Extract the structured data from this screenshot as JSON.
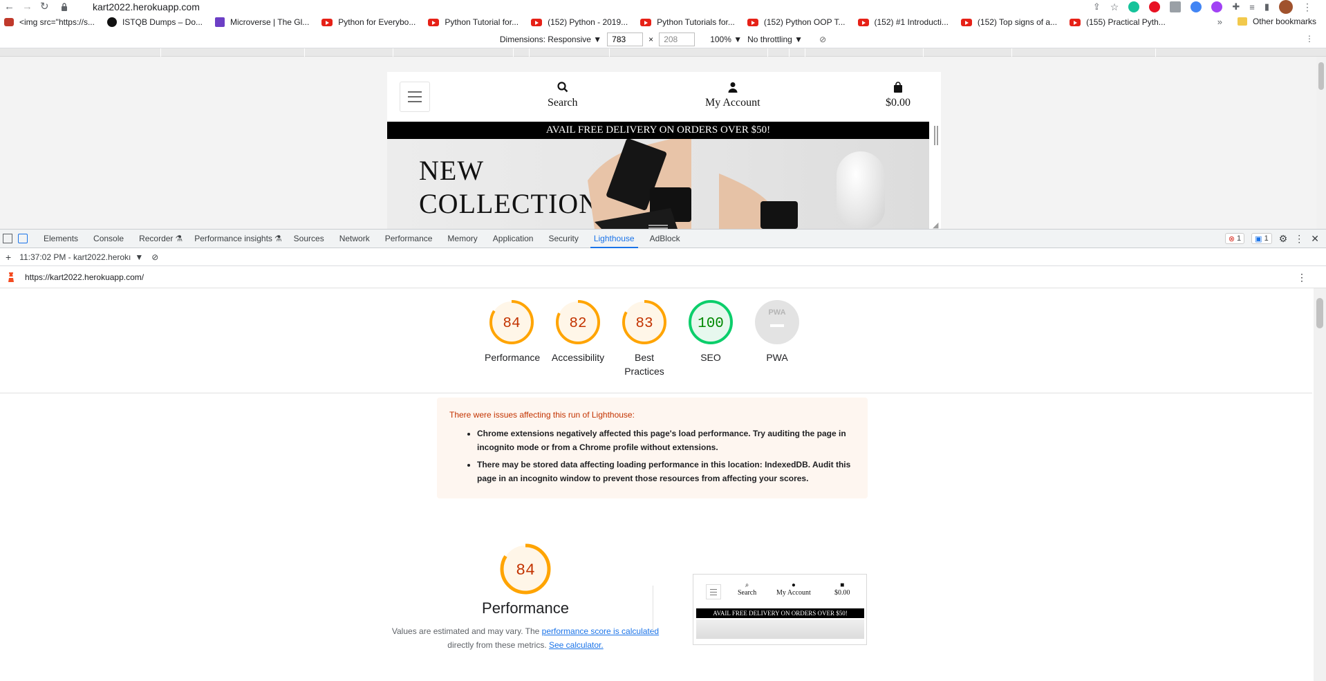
{
  "browser": {
    "url": "kart2022.herokuapp.com",
    "bookmarks": [
      {
        "label": "<img src=\"https://s...",
        "icon": "squirrel-icon"
      },
      {
        "label": "ISTQB Dumps – Do...",
        "icon": "g-logo-icon"
      },
      {
        "label": "Microverse | The Gl...",
        "icon": "microverse-icon"
      },
      {
        "label": "Python for Everybo...",
        "icon": "youtube-icon"
      },
      {
        "label": "Python Tutorial for...",
        "icon": "youtube-icon"
      },
      {
        "label": "(152) Python - 2019...",
        "icon": "youtube-icon"
      },
      {
        "label": "Python Tutorials for...",
        "icon": "youtube-icon"
      },
      {
        "label": "(152) Python OOP T...",
        "icon": "youtube-icon"
      },
      {
        "label": "(152) #1 Introducti...",
        "icon": "youtube-icon"
      },
      {
        "label": "(152) Top signs of a...",
        "icon": "youtube-icon"
      },
      {
        "label": "(155) Practical Pyth...",
        "icon": "youtube-icon"
      }
    ],
    "other_bookmarks": "Other bookmarks",
    "overflow": "»"
  },
  "device_toolbar": {
    "dimensions_label": "Dimensions: Responsive",
    "width": "783",
    "height": "208",
    "times": "×",
    "zoom": "100%",
    "throttling": "No throttling"
  },
  "emulated_page": {
    "search_label": "Search",
    "account_label": "My Account",
    "cart_total": "$0.00",
    "promo_banner": "AVAIL FREE DELIVERY ON ORDERS OVER $50!",
    "hero_line1": "NEW",
    "hero_line2": "COLLECTIONS"
  },
  "devtools": {
    "tabs": [
      "Elements",
      "Console",
      "Recorder",
      "Performance insights",
      "Sources",
      "Network",
      "Performance",
      "Memory",
      "Application",
      "Security",
      "Lighthouse",
      "AdBlock"
    ],
    "active_tab": "Lighthouse",
    "error_count": "1",
    "message_count": "1",
    "report_selector": "11:37:02 PM - kart2022.herokı",
    "report_url": "https://kart2022.herokuapp.com/"
  },
  "lighthouse": {
    "gauges": [
      {
        "label": "Performance",
        "score": "84",
        "color": "#ffa400"
      },
      {
        "label": "Accessibility",
        "score": "82",
        "color": "#ffa400"
      },
      {
        "label": "Best Practices",
        "score": "83",
        "color": "#ffa400"
      },
      {
        "label": "SEO",
        "score": "100",
        "color": "#0cce6b"
      },
      {
        "label": "PWA",
        "score": "",
        "color": "#cfcfcf"
      }
    ],
    "pwa_badge": "PWA",
    "warning_title": "There were issues affecting this run of Lighthouse:",
    "warnings": [
      "Chrome extensions negatively affected this page's load performance. Try auditing the page in incognito mode or from a Chrome profile without extensions.",
      "There may be stored data affecting loading performance in this location: IndexedDB. Audit this page in an incognito window to prevent those resources from affecting your scores."
    ],
    "performance_score": "84",
    "performance_title": "Performance",
    "note_prefix": "Values are estimated and may vary. The ",
    "note_link1": "performance score is calculated",
    "note_middle": " directly from these metrics. ",
    "note_link2": "See calculator."
  },
  "colors": {
    "average": "#ffa400",
    "average_text": "#c33300",
    "pass": "#0cce6b",
    "pass_text": "#008800",
    "accent": "#1a73e8"
  }
}
